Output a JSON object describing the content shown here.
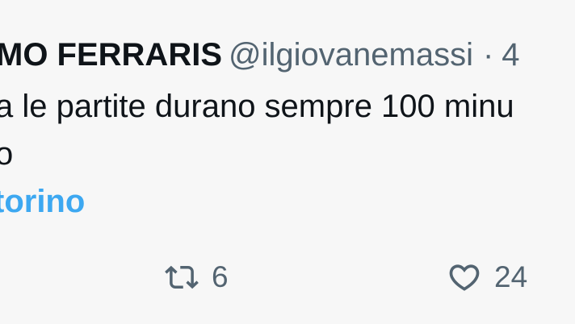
{
  "tweet": {
    "author_name": "MO FERRARIS",
    "handle": "@ilgiovanemassi",
    "separator": "·",
    "time": "4",
    "text_line_1": "a le partite durano sempre 100 minu",
    "text_line_2": "o",
    "hashtag": "torino"
  },
  "actions": {
    "retweet": {
      "icon": "retweet-icon",
      "count": "6"
    },
    "like": {
      "icon": "heart-icon",
      "count": "24"
    }
  },
  "colors": {
    "background": "#f7f7f7",
    "text": "#0f1419",
    "muted": "#536471",
    "link": "#1d9bf0"
  }
}
